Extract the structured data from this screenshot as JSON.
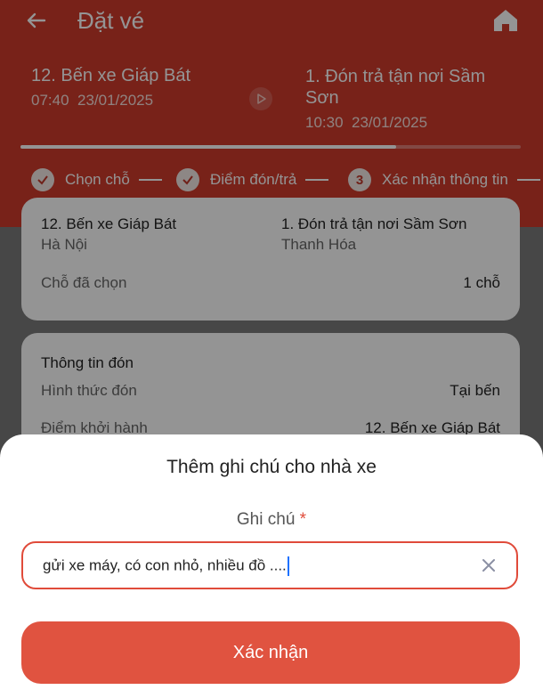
{
  "header": {
    "title": "Đặt vé"
  },
  "route": {
    "from_name": "12. Bến xe Giáp Bát",
    "from_time": "07:40",
    "from_date": "23/01/2025",
    "to_name": "1. Đón trả tận nơi Sầm Sơn",
    "to_time": "10:30",
    "to_date": "23/01/2025"
  },
  "progress": {
    "fraction": 0.75
  },
  "steps": [
    {
      "label": "Chọn chỗ",
      "status": "done"
    },
    {
      "label": "Điểm đón/trả",
      "status": "done"
    },
    {
      "number": "3",
      "label": "Xác nhận thông tin",
      "status": "current"
    }
  ],
  "summary": {
    "from_name": "12. Bến xe Giáp Bát",
    "from_city": "Hà Nội",
    "to_name": "1. Đón trả tận nơi Sầm Sơn",
    "to_city": "Thanh Hóa",
    "seats_label": "Chỗ đã chọn",
    "seats_value": "1 chỗ"
  },
  "pickup": {
    "title": "Thông tin đón",
    "method_label": "Hình thức đón",
    "method_value": "Tại bến",
    "depart_label": "Điểm khởi hành",
    "depart_value": "12. Bến xe Giáp Bát"
  },
  "sheet": {
    "title": "Thêm ghi chú cho nhà xe",
    "field_label": "Ghi chú",
    "required_mark": "*",
    "note_value": "gửi xe máy, có con nhỏ, nhiều đồ ....",
    "confirm_label": "Xác nhận"
  },
  "colors": {
    "brand": "#cf3b2c",
    "button": "#e05340",
    "caret": "#1e72ff"
  }
}
